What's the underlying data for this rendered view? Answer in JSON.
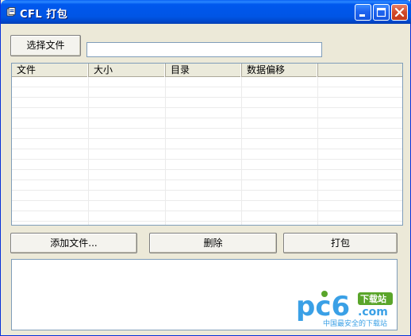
{
  "window": {
    "title": "CFL 打包",
    "icon": "app-icon",
    "controls": [
      "minimize-icon",
      "maximize-icon",
      "close-icon"
    ]
  },
  "toolbar": {
    "select_file_label": "选择文件",
    "path_value": ""
  },
  "file_list": {
    "columns": [
      "文件",
      "大小",
      "目录",
      "数据偏移"
    ],
    "rows": []
  },
  "actions": {
    "add_file_label": "添加文件...",
    "delete_label": "删除",
    "pack_label": "打包"
  },
  "log": {
    "text": ""
  },
  "watermark": {
    "logo": "pc6",
    "dotcom": ".com",
    "badge": "下载站",
    "tagline": "中国最安全的下载站"
  },
  "colors": {
    "titlebar": "#0055e5",
    "window_bg": "#ece9d8",
    "input_border": "#7f9db9",
    "watermark_blue": "#3aa0e6",
    "watermark_green": "#5aa52a"
  }
}
